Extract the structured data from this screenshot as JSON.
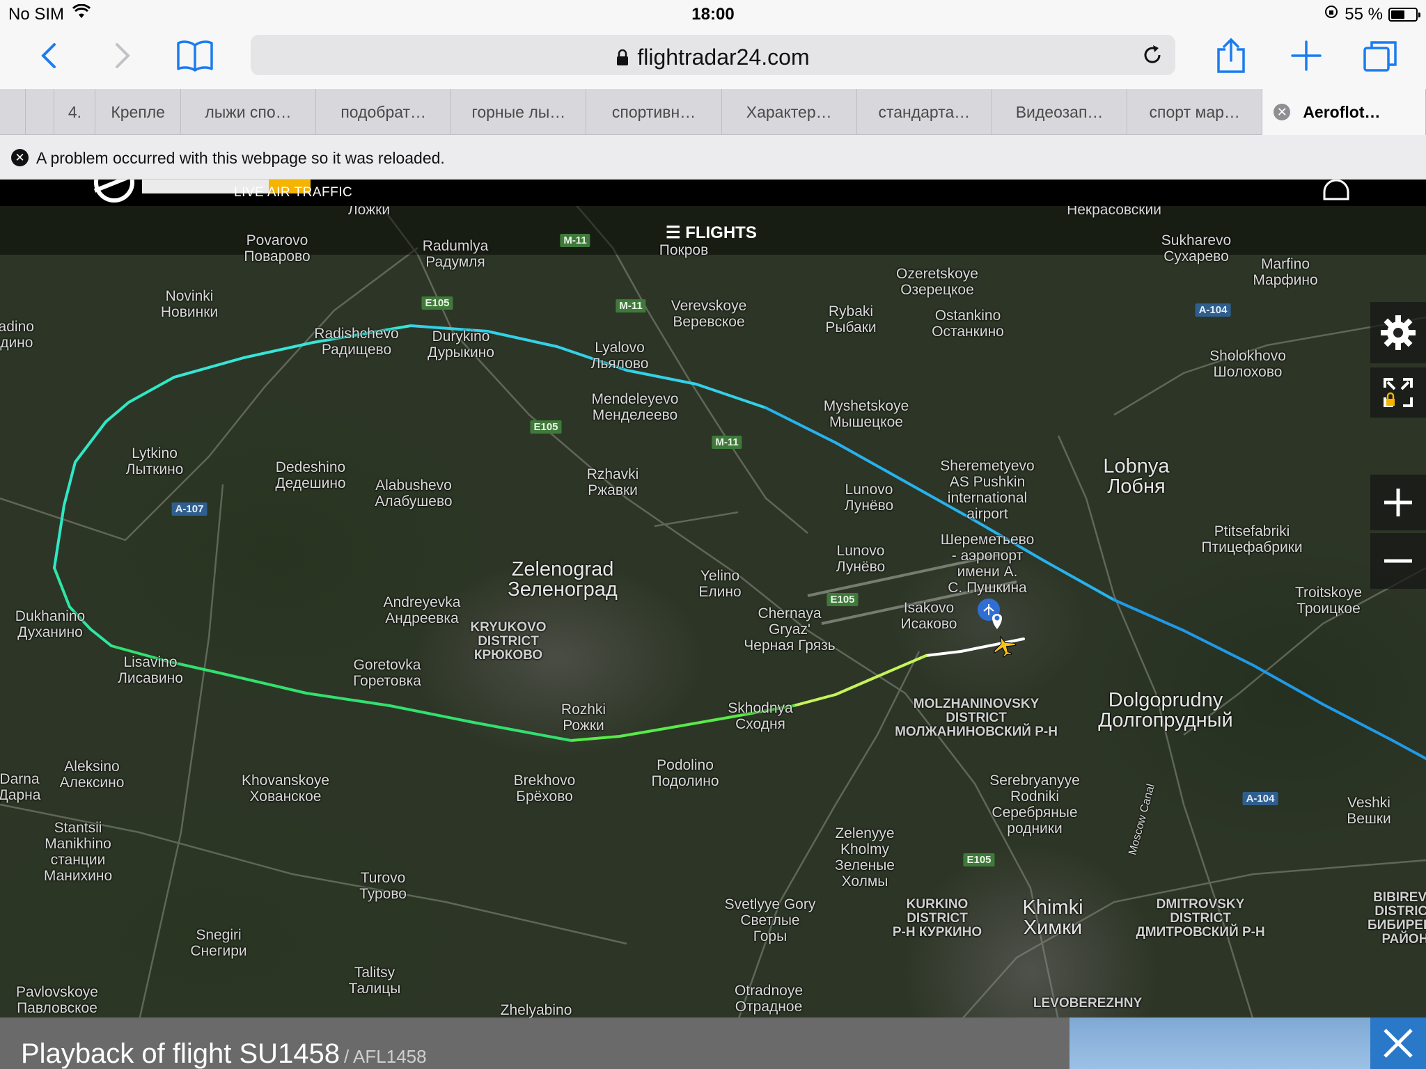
{
  "status_bar": {
    "carrier": "No SIM",
    "time": "18:00",
    "battery_percent": "55 %",
    "battery_level": 0.55
  },
  "browser": {
    "url_host": "flightradar24.com",
    "tabs": [
      "4.",
      "Крепле",
      "лыжи спо…",
      "подобрат…",
      "горные лы…",
      "спортивн…",
      "Характер…",
      "стандарта…",
      "Видеозап…",
      "спорт мар…",
      "Aeroflot…"
    ],
    "active_tab": "Aeroflot…",
    "notice": "A problem occurred with this webpage so it was reloaded."
  },
  "site": {
    "tagline": "LIVE AIR TRAFFIC",
    "flights_button": "FLIGHTS"
  },
  "map": {
    "places": [
      {
        "id": "povarovo",
        "text": "Povarovo\nПоварово"
      },
      {
        "id": "radumlya",
        "text": "Radumlya\nРадумля"
      },
      {
        "id": "pokrov",
        "text": "Покров"
      },
      {
        "id": "sukharevo",
        "text": "Sukharevo\nСухарево"
      },
      {
        "id": "marfino",
        "text": "Marfino\nМарфино"
      },
      {
        "id": "novinki",
        "text": "Novinki\nНовинки"
      },
      {
        "id": "verevskoye",
        "text": "Verevskoye\nВеревское"
      },
      {
        "id": "ozeretskoye",
        "text": "Ozeretskoye\nОзерецкое"
      },
      {
        "id": "rybaki",
        "text": "Rybaki\nРыбаки"
      },
      {
        "id": "ostankino",
        "text": "Ostankino\nОстанкино"
      },
      {
        "id": "radishchevo",
        "text": "Radishchevo\nРадищево"
      },
      {
        "id": "durykino",
        "text": "Durykino\nДурыкино"
      },
      {
        "id": "lyalovo",
        "text": "Lyalovo\nЛьялово"
      },
      {
        "id": "sholokhovo",
        "text": "Sholokhovo\nШолохово"
      },
      {
        "id": "vadino",
        "text": "vadino\nадино"
      },
      {
        "id": "mendeleyevo",
        "text": "Mendeleyevo\nМенделеево"
      },
      {
        "id": "myshetskoye",
        "text": "Myshetskoye\nМышецкое"
      },
      {
        "id": "lytkino",
        "text": "Lytkino\nЛыткино"
      },
      {
        "id": "dedeshino",
        "text": "Dedeshino\nДедешино"
      },
      {
        "id": "alabushevo",
        "text": "Alabushevo\nАлабушево"
      },
      {
        "id": "rzhavki",
        "text": "Rzhavki\nРжавки"
      },
      {
        "id": "lunovo1",
        "text": "Lunovo\nЛунёво"
      },
      {
        "id": "sheremetyevo",
        "text": "Sheremetyevo\nAS Pushkin\ninternational\nairport"
      },
      {
        "id": "sheremetyevo_ru",
        "text": "Шереметьево\n- аэропорт\nимени А.\nС. Пушкина"
      },
      {
        "id": "lobnya",
        "text": "Lobnya\nЛобня"
      },
      {
        "id": "ptitsefabriki",
        "text": "Ptitsefabriki\nПтицефабрики"
      },
      {
        "id": "lunovo2",
        "text": "Lunovo\nЛунёво"
      },
      {
        "id": "zelenograd",
        "text": "Zelenograd\nЗеленоград"
      },
      {
        "id": "yelino",
        "text": "Yelino\nЕлино"
      },
      {
        "id": "troitskoye",
        "text": "Troitskoye\nТроицкое"
      },
      {
        "id": "andreyevka",
        "text": "Andreyevka\nАндреевка"
      },
      {
        "id": "kryukovo",
        "text": "KRYUKOVO\nDISTRICT\nКРЮКОВО"
      },
      {
        "id": "chernaya",
        "text": "Chernaya\nGryaz'\nЧерная Грязь"
      },
      {
        "id": "isakovo",
        "text": "Isakovo\nИсаково"
      },
      {
        "id": "dukhanino",
        "text": "Dukhanino\nДуханино"
      },
      {
        "id": "lisavino",
        "text": "Lisavino\nЛисавино"
      },
      {
        "id": "goretovka",
        "text": "Goretovka\nГоретовка"
      },
      {
        "id": "rozhki",
        "text": "Rozhki\nРожки"
      },
      {
        "id": "skhodnya",
        "text": "Skhodnya\nСходня"
      },
      {
        "id": "molzhaninovsky",
        "text": "MOLZHANINOVSKY\nDISTRICT\nМОЛЖАНИНОВСКИЙ Р-Н"
      },
      {
        "id": "dolgoprudny",
        "text": "Dolgoprudny\nДолгопрудный"
      },
      {
        "id": "podolino",
        "text": "Podolino\nПодолино"
      },
      {
        "id": "aleksino",
        "text": "Aleksino\nАлексино"
      },
      {
        "id": "darna",
        "text": "Darna\nДарна"
      },
      {
        "id": "khovanskoye",
        "text": "Khovanskoye\nХованское"
      },
      {
        "id": "brekhovo",
        "text": "Brekhovo\nБрёхово"
      },
      {
        "id": "serebryanyye",
        "text": "Serebryanyye\nRodniki\nСеребряные\nродники"
      },
      {
        "id": "veshki",
        "text": "Veshki\nВешки"
      },
      {
        "id": "stantsii",
        "text": "Stantsii\nManikhino\nстанции\nМанихино"
      },
      {
        "id": "zelenyye",
        "text": "Zelenyye\nKholmy\nЗеленые\nХолмы"
      },
      {
        "id": "turovo",
        "text": "Turovo\nТурово"
      },
      {
        "id": "svetlyye",
        "text": "Svetlyye Gory\nСветлые\nГоры"
      },
      {
        "id": "kurkino",
        "text": "KURKINO\nDISTRICT\nР-Н КУРКИНО"
      },
      {
        "id": "khimki",
        "text": "Khimki\nХимки"
      },
      {
        "id": "dmitrovsky",
        "text": "DMITROVSKY\nDISTRICT\nДМИТРОВСКИЙ Р-Н"
      },
      {
        "id": "bibirevo",
        "text": "BIBIREVO\nDISTRICT\nБИБИРЕВО\nРАЙОН"
      },
      {
        "id": "snegiri",
        "text": "Snegiri\nСнегири"
      },
      {
        "id": "talitsy",
        "text": "Talitsy\nТалицы"
      },
      {
        "id": "pavlovskoye",
        "text": "Pavlovskoye\nПавловское"
      },
      {
        "id": "otradnoye",
        "text": "Otradnoye\nОтрадное"
      },
      {
        "id": "zhelyabino",
        "text": "Zhelyabino"
      },
      {
        "id": "levoberezhny",
        "text": "LEVOBEREZHNY"
      },
      {
        "id": "nekrasovsky",
        "text": "Некрасовский"
      },
      {
        "id": "lozhki",
        "text": "Ложки"
      },
      {
        "id": "moscow_canal",
        "text": "Moscow Canal"
      }
    ],
    "road_shields": [
      {
        "id": "m11a",
        "text": "M-11",
        "kind": "m"
      },
      {
        "id": "e105a",
        "text": "E105",
        "kind": "e"
      },
      {
        "id": "m11b",
        "text": "M-11",
        "kind": "m"
      },
      {
        "id": "a104a",
        "text": "A-104",
        "kind": "a"
      },
      {
        "id": "e105b",
        "text": "E105",
        "kind": "e"
      },
      {
        "id": "m11c",
        "text": "M-11",
        "kind": "m"
      },
      {
        "id": "a107",
        "text": "A-107",
        "kind": "a"
      },
      {
        "id": "e105c",
        "text": "E105",
        "kind": "e"
      },
      {
        "id": "a104b",
        "text": "A-104",
        "kind": "a"
      },
      {
        "id": "e105d",
        "text": "E105",
        "kind": "e"
      }
    ]
  },
  "playback": {
    "title": "Playback of flight SU1458",
    "subtitle": "/ AFL1458"
  }
}
